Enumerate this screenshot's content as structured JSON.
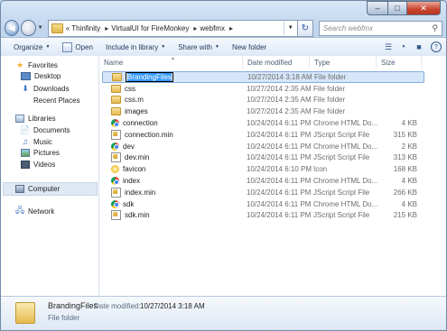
{
  "window": {
    "controls": {
      "minimize": "–",
      "maximize": "□",
      "close": "✕"
    }
  },
  "address": {
    "overflow": "«",
    "crumbs": [
      "Thinfinity",
      "VirtualUI for FireMonkey",
      "webfmx"
    ],
    "separator": "▸"
  },
  "search": {
    "placeholder": "Search webfmx",
    "icon": "search-icon"
  },
  "toolbar": {
    "organize": "Organize",
    "open": "Open",
    "include": "Include in library",
    "share": "Share with",
    "newfolder": "New folder"
  },
  "sidebar": {
    "favorites": "Favorites",
    "desktop": "Desktop",
    "downloads": "Downloads",
    "recent": "Recent Places",
    "libraries": "Libraries",
    "documents": "Documents",
    "music": "Music",
    "pictures": "Pictures",
    "videos": "Videos",
    "computer": "Computer",
    "network": "Network"
  },
  "columns": {
    "name": "Name",
    "date": "Date modified",
    "type": "Type",
    "size": "Size"
  },
  "files": [
    {
      "name": "BrandingFiles",
      "date": "10/27/2014 3:18 AM",
      "type": "File folder",
      "size": "",
      "icon": "folder"
    },
    {
      "name": "css",
      "date": "10/27/2014 2:35 AM",
      "type": "File folder",
      "size": "",
      "icon": "folder"
    },
    {
      "name": "css.m",
      "date": "10/27/2014 2:35 AM",
      "type": "File folder",
      "size": "",
      "icon": "folder"
    },
    {
      "name": "images",
      "date": "10/27/2014 2:35 AM",
      "type": "File folder",
      "size": "",
      "icon": "folder"
    },
    {
      "name": "connection",
      "date": "10/24/2014 6:11 PM",
      "type": "Chrome HTML Do...",
      "size": "4 KB",
      "icon": "chrome"
    },
    {
      "name": "connection.min",
      "date": "10/24/2014 6:11 PM",
      "type": "JScript Script File",
      "size": "315 KB",
      "icon": "script"
    },
    {
      "name": "dev",
      "date": "10/24/2014 6:11 PM",
      "type": "Chrome HTML Do...",
      "size": "2 KB",
      "icon": "chrome"
    },
    {
      "name": "dev.min",
      "date": "10/24/2014 6:11 PM",
      "type": "JScript Script File",
      "size": "313 KB",
      "icon": "script"
    },
    {
      "name": "favicon",
      "date": "10/24/2014 6:10 PM",
      "type": "Icon",
      "size": "168 KB",
      "icon": "favicon"
    },
    {
      "name": "index",
      "date": "10/24/2014 6:11 PM",
      "type": "Chrome HTML Do...",
      "size": "4 KB",
      "icon": "chrome"
    },
    {
      "name": "index.min",
      "date": "10/24/2014 6:11 PM",
      "type": "JScript Script File",
      "size": "266 KB",
      "icon": "script"
    },
    {
      "name": "sdk",
      "date": "10/24/2014 6:11 PM",
      "type": "Chrome HTML Do...",
      "size": "4 KB",
      "icon": "chrome"
    },
    {
      "name": "sdk.min",
      "date": "10/24/2014 6:11 PM",
      "type": "JScript Script File",
      "size": "215 KB",
      "icon": "script"
    }
  ],
  "details": {
    "name": "BrandingFiles",
    "modified_label": "Date modified:",
    "modified_value": "10/27/2014 3:18 AM",
    "type": "File folder"
  }
}
